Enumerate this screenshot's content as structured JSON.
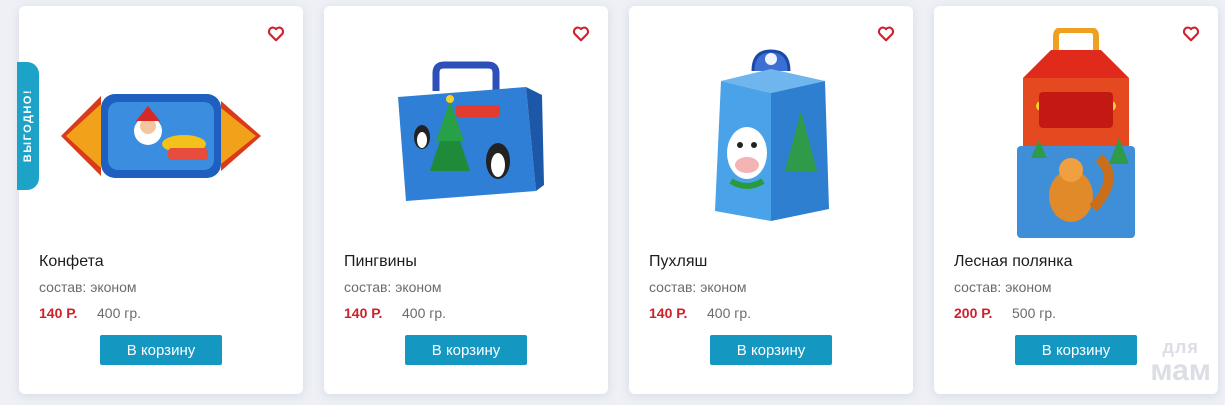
{
  "products": [
    {
      "title": "Конфета",
      "composition": "состав: эконом",
      "price": "140 Р.",
      "weight": "400 гр.",
      "button": "В корзину",
      "badge": "ВЫГОДНО!",
      "image_icon": "candy-box-icon"
    },
    {
      "title": "Пингвины",
      "composition": "состав: эконом",
      "price": "140 Р.",
      "weight": "400 гр.",
      "button": "В корзину",
      "image_icon": "penguin-box-icon"
    },
    {
      "title": "Пухляш",
      "composition": "состав: эконом",
      "price": "140 Р.",
      "weight": "400 гр.",
      "button": "В корзину",
      "image_icon": "cow-box-icon"
    },
    {
      "title": "Лесная полянка",
      "composition": "состав: эконом",
      "price": "200 Р.",
      "weight": "500 гр.",
      "button": "В корзину",
      "image_icon": "squirrel-house-box-icon"
    }
  ],
  "watermark": {
    "line1": "для",
    "line2": "мам"
  },
  "colors": {
    "price": "#d0202c",
    "button": "#1498c2",
    "badge": "#1ea3c8",
    "heart": "#d0202c"
  }
}
